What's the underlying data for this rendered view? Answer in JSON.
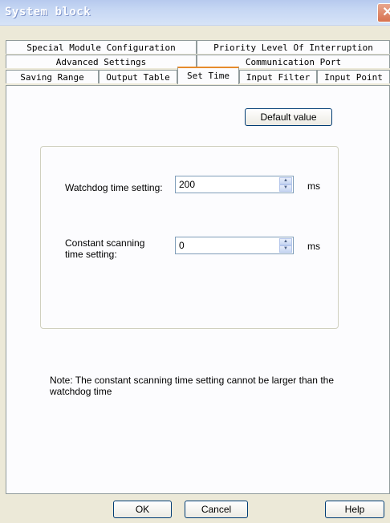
{
  "window": {
    "title": "System block",
    "close_glyph": "✕"
  },
  "tabs": {
    "row1": [
      "Special Module Configuration",
      "Priority Level Of Interruption"
    ],
    "row2": [
      "Advanced Settings",
      "Communication Port"
    ],
    "row3": [
      "Saving Range",
      "Output Table",
      "Set Time",
      "Input Filter",
      "Input Point"
    ],
    "active": "Set Time"
  },
  "panel": {
    "default_button": "Default value",
    "watchdog": {
      "label": "Watchdog time setting:",
      "value": "200",
      "unit": "ms"
    },
    "scanning": {
      "label": "Constant scanning time setting:",
      "value": "0",
      "unit": "ms"
    },
    "note": "Note: The constant scanning time setting cannot be larger than the watchdog time"
  },
  "buttons": {
    "ok": "OK",
    "cancel": "Cancel",
    "help": "Help"
  },
  "icons": {
    "spin_up": "▲",
    "spin_down": "▼"
  }
}
